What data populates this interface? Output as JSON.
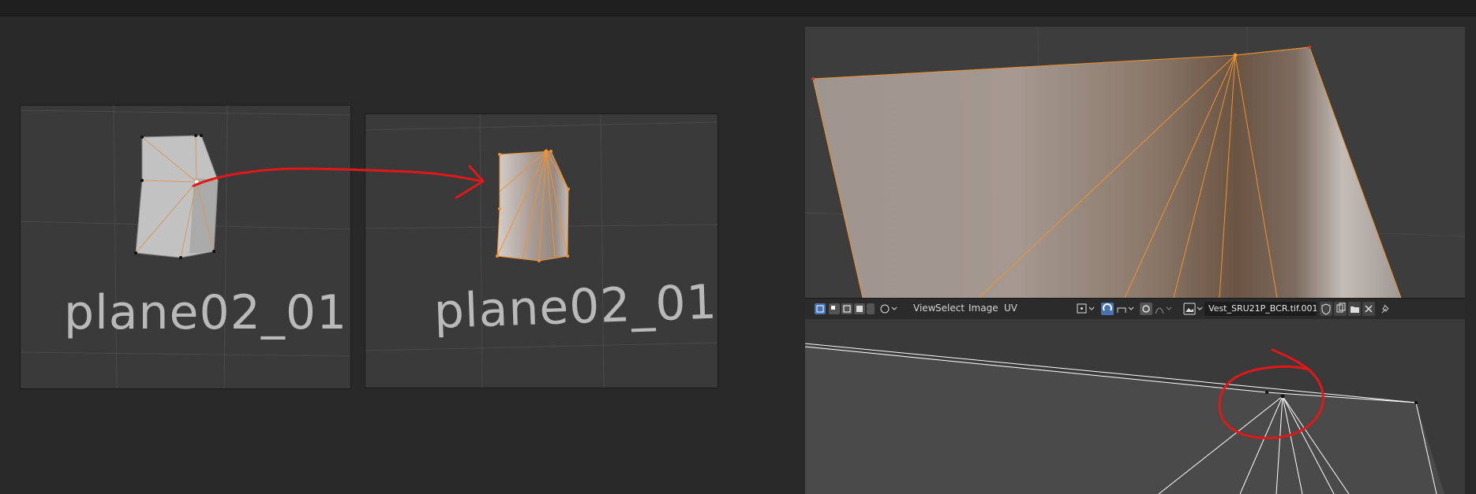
{
  "left_panels": {
    "before_label": "plane02_01",
    "after_label": "plane02_01"
  },
  "uv_editor": {
    "header": {
      "menus": [
        "View",
        "Select",
        "Image",
        "UV"
      ],
      "image_name": "Vest_SRU21P_BCR.tif.001",
      "icons": [
        "sync-selection-icon",
        "vertex-select-icon",
        "edge-select-icon",
        "face-select-icon",
        "island-select-icon",
        "sticky-mode-icon",
        "pivot-icon",
        "snap-icon",
        "snap-target-icon",
        "proportional-edit-icon",
        "falloff-icon",
        "image-browse-icon",
        "fake-user-shield-icon",
        "duplicate-image-icon",
        "open-image-folder-icon",
        "unlink-image-icon",
        "pin-icon"
      ]
    }
  },
  "colors": {
    "background": "#292929",
    "viewport": "#3a3a3a",
    "selection_orange": "#f0922e",
    "annotation_red": "#e01818",
    "header": "#2b2b2b",
    "active_toggle": "#4772b3"
  }
}
